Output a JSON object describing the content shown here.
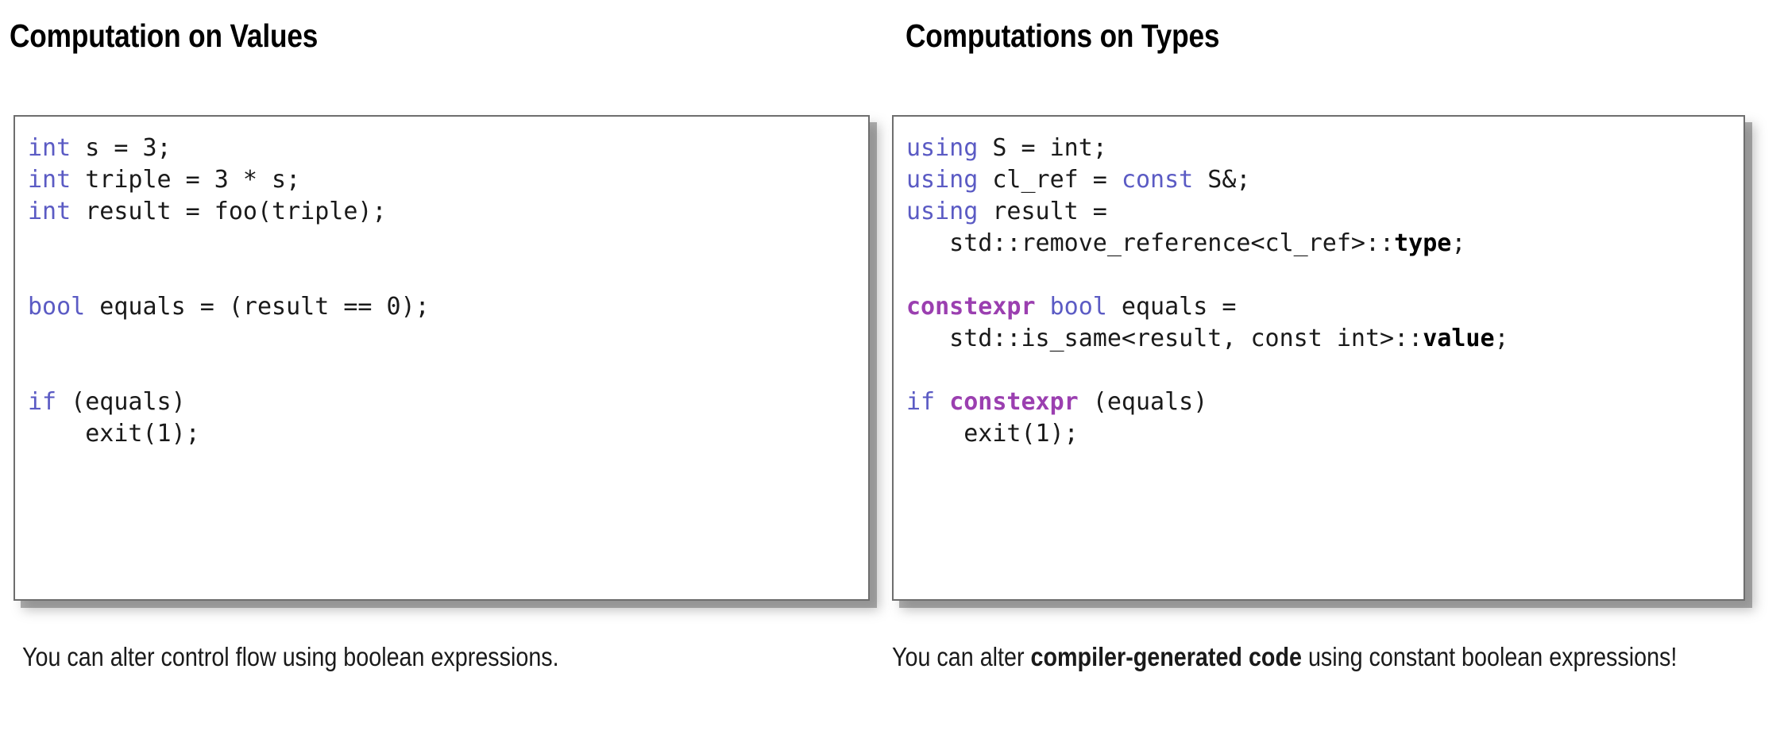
{
  "slide": {
    "background_color": "#ffffff",
    "syntax_colors": {
      "keyword_blue": "#5b5bc4",
      "constexpr_purple": "#9b3fb0",
      "member_bold_black": "#000000",
      "code_default": "#1a1a1a",
      "card_border": "#6e6e6e",
      "card_shadow": "#6e6e6e"
    }
  },
  "columns": {
    "left": {
      "title": "Computation on Values",
      "code_lines": [
        [
          {
            "t": "int",
            "s": "kw"
          },
          {
            "t": " s = 3;",
            "s": "plain"
          }
        ],
        [
          {
            "t": "int",
            "s": "kw"
          },
          {
            "t": " triple = 3 * s;",
            "s": "plain"
          }
        ],
        [
          {
            "t": "int",
            "s": "kw"
          },
          {
            "t": " result = foo(triple);",
            "s": "plain"
          }
        ],
        [],
        [],
        [
          {
            "t": "bool",
            "s": "kw"
          },
          {
            "t": " equals = (result == 0);",
            "s": "plain"
          }
        ],
        [],
        [],
        [
          {
            "t": "if",
            "s": "kw"
          },
          {
            "t": " (equals)",
            "s": "plain"
          }
        ],
        [
          {
            "t": "    exit(1);",
            "s": "plain"
          }
        ]
      ],
      "caption": [
        {
          "t": "You can alter control flow using boolean expressions.",
          "s": "plain"
        }
      ]
    },
    "right": {
      "title": "Computations on Types",
      "code_lines": [
        [
          {
            "t": "using",
            "s": "kw"
          },
          {
            "t": " S = int;",
            "s": "plain"
          }
        ],
        [
          {
            "t": "using",
            "s": "kw"
          },
          {
            "t": " cl_ref = ",
            "s": "plain"
          },
          {
            "t": "const",
            "s": "kw"
          },
          {
            "t": " S&;",
            "s": "plain"
          }
        ],
        [
          {
            "t": "using",
            "s": "kw"
          },
          {
            "t": " result =",
            "s": "plain"
          }
        ],
        [
          {
            "t": "   std::remove_reference<cl_ref>::",
            "s": "plain"
          },
          {
            "t": "type",
            "s": "mem"
          },
          {
            "t": ";",
            "s": "plain"
          }
        ],
        [],
        [
          {
            "t": "constexpr",
            "s": "kw-ce"
          },
          {
            "t": " ",
            "s": "plain"
          },
          {
            "t": "bool",
            "s": "kw"
          },
          {
            "t": " equals =",
            "s": "plain"
          }
        ],
        [
          {
            "t": "   std::is_same<result, const int>::",
            "s": "plain"
          },
          {
            "t": "value",
            "s": "mem"
          },
          {
            "t": ";",
            "s": "plain"
          }
        ],
        [],
        [
          {
            "t": "if",
            "s": "kw"
          },
          {
            "t": " ",
            "s": "plain"
          },
          {
            "t": "constexpr",
            "s": "kw-ce"
          },
          {
            "t": " (equals)",
            "s": "plain"
          }
        ],
        [
          {
            "t": "    exit(1);",
            "s": "plain"
          }
        ]
      ],
      "caption": [
        {
          "t": "You can alter ",
          "s": "plain"
        },
        {
          "t": "compiler-generated code",
          "s": "bold"
        },
        {
          "t": " using constant boolean expressions!",
          "s": "plain"
        }
      ]
    }
  }
}
